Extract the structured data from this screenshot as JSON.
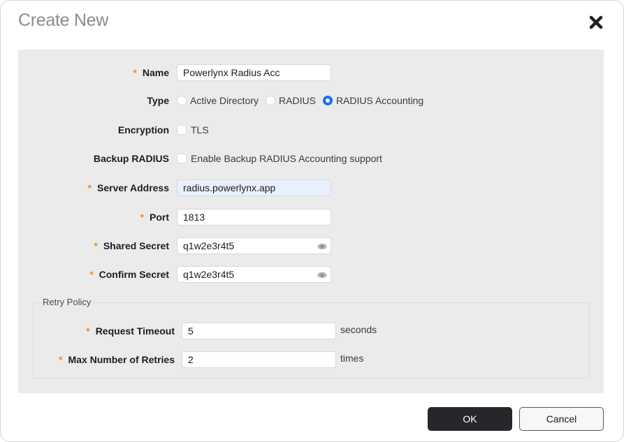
{
  "dialog": {
    "title": "Create New",
    "close_icon": "close-icon"
  },
  "form": {
    "name": {
      "label": "Name",
      "required": true,
      "value": "Powerlynx Radius Acc"
    },
    "type": {
      "label": "Type",
      "options": [
        "Active Directory",
        "RADIUS",
        "RADIUS Accounting"
      ],
      "selected": "RADIUS Accounting"
    },
    "encryption": {
      "label": "Encryption",
      "checkbox_label": "TLS",
      "checked": false
    },
    "backup_radius": {
      "label": "Backup RADIUS",
      "checkbox_label": "Enable Backup RADIUS Accounting support",
      "checked": false
    },
    "server_address": {
      "label": "Server Address",
      "required": true,
      "value": "radius.powerlynx.app"
    },
    "port": {
      "label": "Port",
      "required": true,
      "value": "1813"
    },
    "shared_secret": {
      "label": "Shared Secret",
      "required": true,
      "value": "q1w2e3r4t5",
      "icon": "eye-icon"
    },
    "confirm_secret": {
      "label": "Confirm Secret",
      "required": true,
      "value": "q1w2e3r4t5",
      "icon": "eye-icon"
    },
    "required_marker": "*"
  },
  "retry_policy": {
    "legend": "Retry Policy",
    "request_timeout": {
      "label": "Request Timeout",
      "required": true,
      "value": "5",
      "unit": "seconds"
    },
    "max_retries": {
      "label": "Max Number of Retries",
      "required": true,
      "value": "2",
      "unit": "times"
    }
  },
  "footer": {
    "ok_label": "OK",
    "cancel_label": "Cancel"
  },
  "colors": {
    "accent": "#1e6ff0",
    "required": "#f08c1e",
    "primary_button": "#25272a"
  }
}
